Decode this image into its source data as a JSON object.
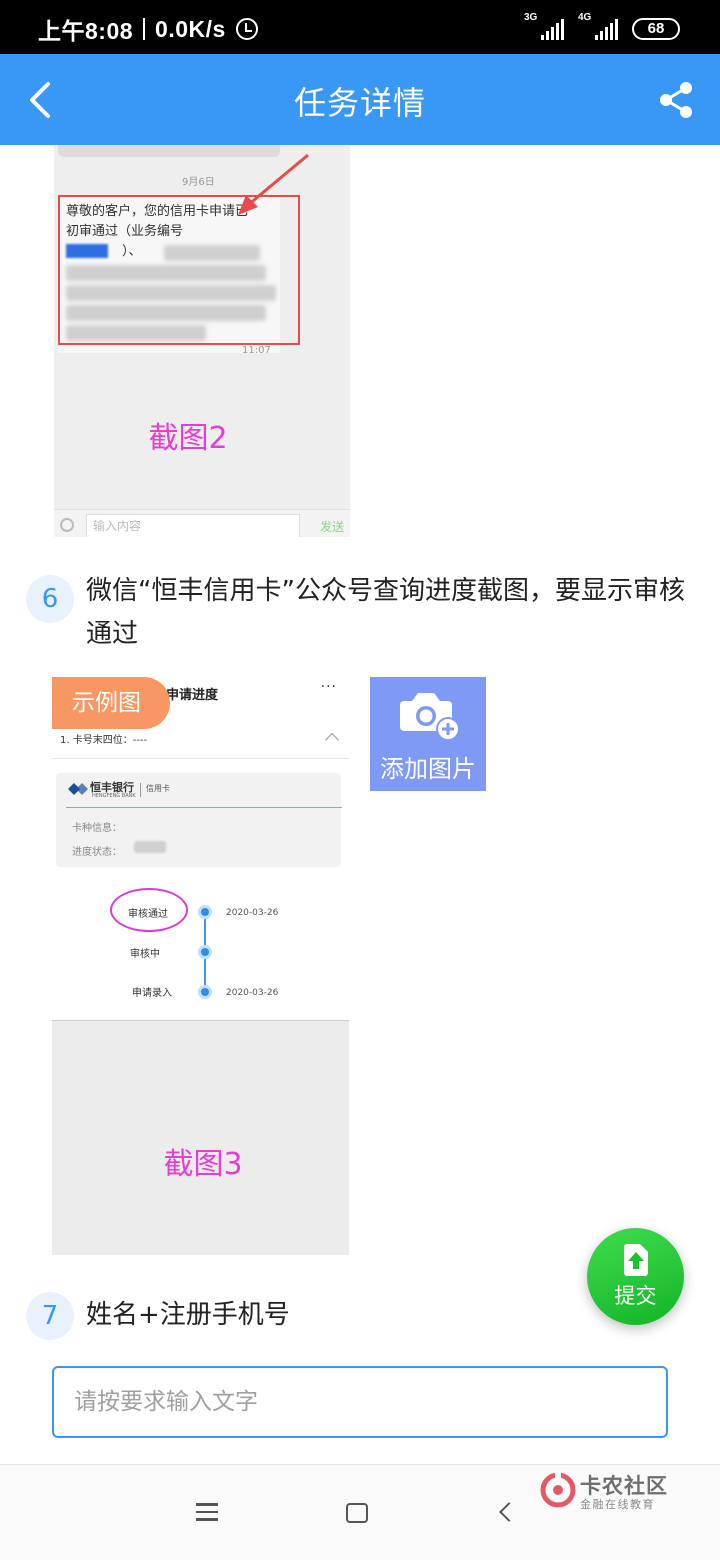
{
  "status_bar": {
    "time": "上午8:08",
    "speed": "0.0K/s",
    "network1": "3G",
    "network2": "4G",
    "battery": "68"
  },
  "header": {
    "title": "任务详情"
  },
  "example2": {
    "date": "9月6日",
    "message_line1": "尊敬的客户，您的信用卡申请已",
    "message_line2": "初审通过（业务编号",
    "message_line3": "）、",
    "time": "11:07",
    "caption": "截图2",
    "input_placeholder": "输入内容",
    "send_label": "发送"
  },
  "question6": {
    "number": "6",
    "text": "微信“恒丰信用卡”公众号查询进度截图，要显示审核通过"
  },
  "example3": {
    "badge": "示例图",
    "app_title": "申请进度",
    "menu_dots": "···",
    "card_tail": "1. 卡号末四位：----",
    "bank_name": "恒丰银行",
    "bank_en": "HENGFENG BANK",
    "card_type": "信用卡",
    "card_info_label": "卡种信息：",
    "progress_label": "进度状态：",
    "timeline": [
      {
        "label": "审核通过",
        "date": "2020-03-26"
      },
      {
        "label": "审核中",
        "date": ""
      },
      {
        "label": "申请录入",
        "date": "2020-03-26"
      }
    ],
    "caption": "截图3"
  },
  "add_image": {
    "label": "添加图片"
  },
  "submit": {
    "label": "提交"
  },
  "question7": {
    "number": "7",
    "text": "姓名+注册手机号"
  },
  "text_input": {
    "placeholder": "请按要求输入文字",
    "value": ""
  },
  "watermark": {
    "name": "卡农社区",
    "sub": "金融在线教育"
  },
  "colors": {
    "header": "#3a98f5",
    "accent_pink": "#e33fd5",
    "badge": "#f79864",
    "add_image": "#7e9af5",
    "submit": "#1ec22f"
  }
}
